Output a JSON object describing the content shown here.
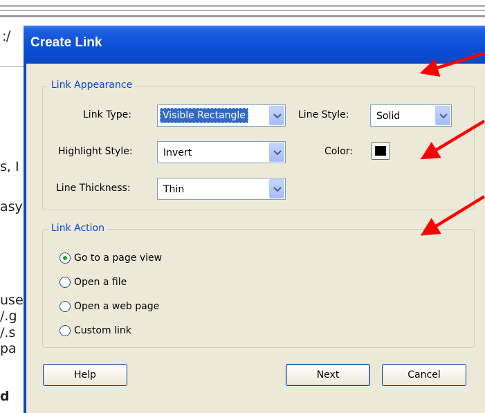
{
  "background": {
    "url_fragment": ":/",
    "text_fragments": [
      "s, I",
      "asy",
      "use",
      "/.g",
      "/.s",
      "pa",
      "d"
    ]
  },
  "dialog": {
    "title": "Create Link",
    "link_appearance": {
      "legend": "Link Appearance",
      "link_type_label": "Link Type:",
      "link_type_value": "Visible Rectangle",
      "line_style_label": "Line Style:",
      "line_style_value": "Solid",
      "highlight_style_label": "Highlight Style:",
      "highlight_style_value": "Invert",
      "color_label": "Color:",
      "color_value": "#000000",
      "line_thickness_label": "Line Thickness:",
      "line_thickness_value": "Thin"
    },
    "link_action": {
      "legend": "Link Action",
      "options": [
        {
          "label": "Go to a page view",
          "selected": true
        },
        {
          "label": "Open a file",
          "selected": false
        },
        {
          "label": "Open a web page",
          "selected": false
        },
        {
          "label": "Custom link",
          "selected": false
        }
      ]
    },
    "buttons": {
      "help": "Help",
      "next": "Next",
      "cancel": "Cancel"
    }
  },
  "colors": {
    "title_bar": "#0b47c4",
    "dialog_bg": "#ece9d8",
    "group_legend": "#0046d5",
    "annotation_arrow": "#ff0000",
    "radio_dot": "#21a121"
  }
}
